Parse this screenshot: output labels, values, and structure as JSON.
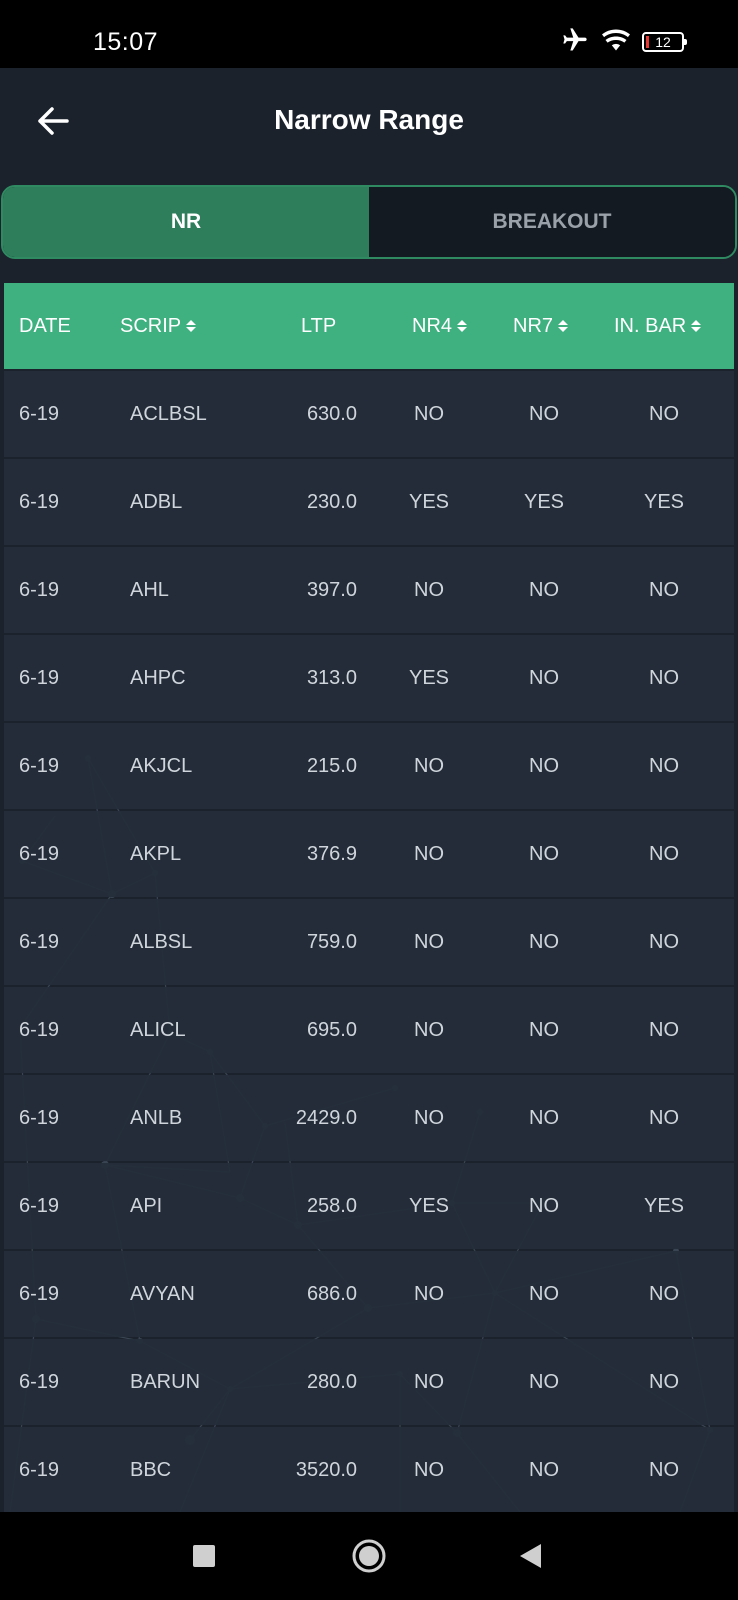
{
  "status_bar": {
    "time": "15:07",
    "battery": "12",
    "icons": [
      "airplane-icon",
      "wifi-icon",
      "battery-icon"
    ]
  },
  "header": {
    "title": "Narrow Range",
    "back_icon": "arrow-left-icon"
  },
  "tabs": [
    {
      "label": "NR",
      "active": true
    },
    {
      "label": "BREAKOUT",
      "active": false
    }
  ],
  "colors": {
    "accent": "#3fb080",
    "tab_active": "#2e7d5b",
    "background": "#1b222c",
    "row": "#242e3a"
  },
  "table": {
    "columns": [
      "DATE",
      "SCRIP",
      "LTP",
      "NR4",
      "NR7",
      "IN. BAR"
    ],
    "sortable": [
      false,
      true,
      false,
      true,
      true,
      true
    ],
    "rows": [
      [
        "6-19",
        "ACLBSL",
        "630.0",
        "NO",
        "NO",
        "NO"
      ],
      [
        "6-19",
        "ADBL",
        "230.0",
        "YES",
        "YES",
        "YES"
      ],
      [
        "6-19",
        "AHL",
        "397.0",
        "NO",
        "NO",
        "NO"
      ],
      [
        "6-19",
        "AHPC",
        "313.0",
        "YES",
        "NO",
        "NO"
      ],
      [
        "6-19",
        "AKJCL",
        "215.0",
        "NO",
        "NO",
        "NO"
      ],
      [
        "6-19",
        "AKPL",
        "376.9",
        "NO",
        "NO",
        "NO"
      ],
      [
        "6-19",
        "ALBSL",
        "759.0",
        "NO",
        "NO",
        "NO"
      ],
      [
        "6-19",
        "ALICL",
        "695.0",
        "NO",
        "NO",
        "NO"
      ],
      [
        "6-19",
        "ANLB",
        "2429.0",
        "NO",
        "NO",
        "NO"
      ],
      [
        "6-19",
        "API",
        "258.0",
        "YES",
        "NO",
        "YES"
      ],
      [
        "6-19",
        "AVYAN",
        "686.0",
        "NO",
        "NO",
        "NO"
      ],
      [
        "6-19",
        "BARUN",
        "280.0",
        "NO",
        "NO",
        "NO"
      ],
      [
        "6-19",
        "BBC",
        "3520.0",
        "NO",
        "NO",
        "NO"
      ]
    ]
  },
  "nav_bar": {
    "buttons": [
      "recents-square-icon",
      "home-circle-icon",
      "back-triangle-icon"
    ]
  }
}
